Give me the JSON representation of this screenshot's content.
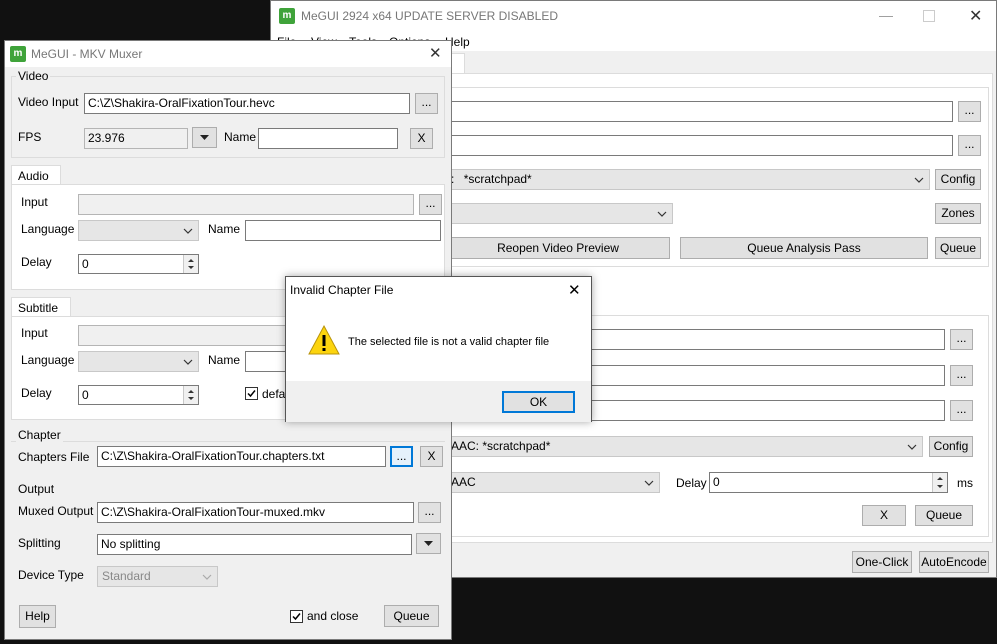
{
  "main_window": {
    "title": "MeGUI 2924 x64 UPDATE SERVER DISABLED",
    "menu": [
      "File",
      "View",
      "Tools",
      "Options",
      "Help"
    ],
    "tab_fragment": "g",
    "video_preset_combo": "*scratchpad*",
    "video_preset_prefix": ":",
    "config_label": "Config",
    "zones_label": "Zones",
    "reopen_preview_label": "Reopen Video Preview",
    "queue_analysis_label": "Queue Analysis Pass",
    "queue_label": "Queue",
    "audio_preset_combo": "AAC: *scratchpad*",
    "audio_format_combo": "AAC",
    "delay_label": "Delay",
    "delay_value": "0",
    "ms_label": "ms",
    "clear_label": "X",
    "one_click_label": "One-Click",
    "autoencode_label": "AutoEncode",
    "browse_label": "..."
  },
  "muxer": {
    "title": "MeGUI - MKV Muxer",
    "video": {
      "group_label": "Video",
      "input_label": "Video Input",
      "input_value": "C:\\Z\\Shakira-OralFixationTour.hevc",
      "fps_label": "FPS",
      "fps_value": "23.976",
      "name_label": "Name",
      "name_value": "",
      "clear_label": "X"
    },
    "audio": {
      "tab_label": "Audio 1",
      "input_label": "Input",
      "language_label": "Language",
      "name_label": "Name",
      "delay_label": "Delay",
      "delay_value": "0"
    },
    "subtitle": {
      "tab_label": "Subtitle 1",
      "input_label": "Input",
      "language_label": "Language",
      "name_label": "Name",
      "delay_label": "Delay",
      "delay_value": "0",
      "default_label": "defa"
    },
    "chapter": {
      "group_label": "Chapter",
      "file_label": "Chapters File",
      "file_value": "C:\\Z\\Shakira-OralFixationTour.chapters.txt",
      "clear_label": "X"
    },
    "output": {
      "group_label": "Output",
      "muxed_label": "Muxed Output",
      "muxed_value": "C:\\Z\\Shakira-OralFixationTour-muxed.mkv",
      "splitting_label": "Splitting",
      "splitting_value": "No splitting",
      "device_label": "Device Type",
      "device_value": "Standard"
    },
    "help_label": "Help",
    "and_close_label": "and close",
    "queue_label": "Queue",
    "browse_label": "..."
  },
  "dialog": {
    "title": "Invalid Chapter File",
    "message": "The selected file is not a valid chapter file",
    "ok_label": "OK",
    "close_label": "✕"
  }
}
